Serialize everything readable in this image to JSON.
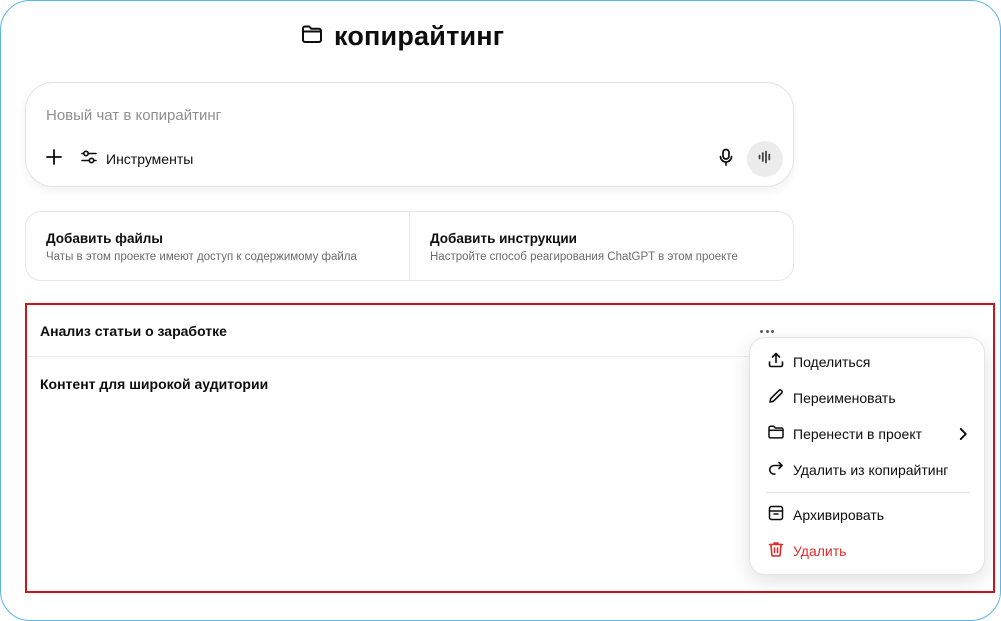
{
  "project": {
    "title": "копирайтинг",
    "icon": "folder-icon"
  },
  "composer": {
    "placeholder": "Новый чат в копирайтинг",
    "value": "",
    "tools_label": "Инструменты",
    "icons": [
      "plus-icon",
      "sliders-icon",
      "microphone-icon",
      "voice-wave-icon"
    ]
  },
  "cards": [
    {
      "title": "Добавить файлы",
      "subtitle": "Чаты в этом проекте имеют доступ к содержимому файла"
    },
    {
      "title": "Добавить инструкции",
      "subtitle": "Настройте способ реагирования ChatGPT в этом проекте"
    }
  ],
  "chats": [
    {
      "title": "Анализ статьи о заработке"
    },
    {
      "title": "Контент для широкой аудитории"
    }
  ],
  "context_menu": {
    "items": [
      {
        "label": "Поделиться",
        "icon": "share-upload-icon"
      },
      {
        "label": "Переименовать",
        "icon": "pencil-icon"
      },
      {
        "label": "Перенести в проект",
        "icon": "folder-icon",
        "submenu": true
      },
      {
        "label": "Удалить из копирайтинг",
        "icon": "redo-arrow-icon"
      },
      {
        "label": "Архивировать",
        "icon": "archive-icon"
      },
      {
        "label": "Удалить",
        "icon": "trash-icon",
        "danger": true
      }
    ]
  },
  "colors": {
    "highlight_border": "#c8141c",
    "danger": "#e02e2a",
    "frame_border": "#5bb8e6"
  }
}
